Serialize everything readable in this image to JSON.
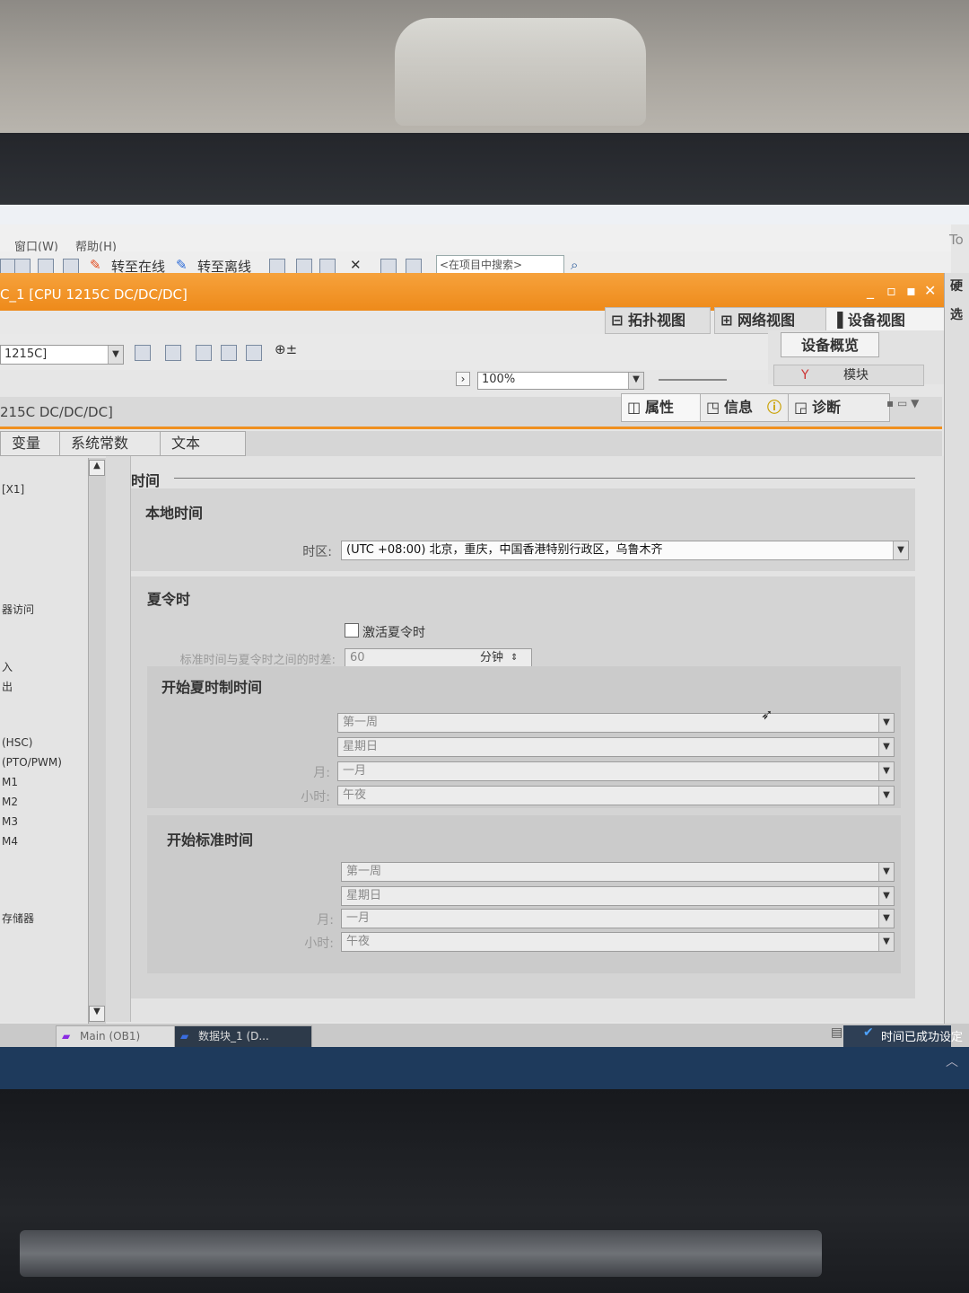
{
  "menu": {
    "window": "窗口(W)",
    "help": "帮助(H)"
  },
  "toolbar": {
    "go_online": "转至在线",
    "go_offline": "转至离线",
    "search_placeholder": "<在项目中搜索>"
  },
  "right_edge": {
    "top_text": "To",
    "tab_1": "硬",
    "tab_2": "选"
  },
  "window": {
    "title": "C_1 [CPU 1215C DC/DC/DC]",
    "buttons": [
      "_",
      "▫",
      "▪",
      "✕"
    ]
  },
  "view_tabs": [
    {
      "label": "拓扑视图",
      "icon": "topology-icon"
    },
    {
      "label": "网络视图",
      "icon": "network-icon"
    },
    {
      "label": "设备视图",
      "icon": "device-icon"
    }
  ],
  "device_bar": {
    "device_select": "1215C]",
    "zoom": "100%"
  },
  "overview": {
    "tab": "设备概览",
    "module_header": "模块"
  },
  "inspector": {
    "title": "215C DC/DC/DC]",
    "tabs": [
      {
        "label": "属性",
        "icon": "properties-icon",
        "active": true
      },
      {
        "label": "信息",
        "icon": "info-icon",
        "active": false
      },
      {
        "label": "诊断",
        "icon": "diagnostics-icon",
        "active": false
      }
    ],
    "subtabs": [
      "变量",
      "系统常数",
      "文本"
    ]
  },
  "left_nav": {
    "items": [
      "[X1]",
      "器访问",
      "入",
      "出",
      "(HSC)",
      "(PTO/PWM)",
      "M1",
      "M2",
      "M3",
      "M4",
      "存储器"
    ]
  },
  "time_settings": {
    "section_title": "时间",
    "local_time": {
      "title": "本地时间",
      "timezone_label": "时区:",
      "timezone_value": "(UTC +08:00) 北京，重庆，中国香港特别行政区，乌鲁木齐"
    },
    "dst": {
      "title": "夏令时",
      "activate_label": "激活夏令时",
      "activate_checked": false,
      "offset_label": "标准时间与夏令时之间的时差:",
      "offset_value": "60",
      "offset_unit": "分钟"
    },
    "dst_start": {
      "title": "开始夏时制时间",
      "week": "第一周",
      "weekday": "星期日",
      "month_label": "月:",
      "month": "一月",
      "hour_label": "小时:",
      "hour": "午夜"
    },
    "std_start": {
      "title": "开始标准时间",
      "week": "第一周",
      "weekday": "星期日",
      "month_label": "月:",
      "month": "一月",
      "hour_label": "小时:",
      "hour": "午夜"
    }
  },
  "status_bar": {
    "tabs": [
      {
        "label": "Main (OB1)",
        "icon": "ob-icon"
      },
      {
        "label": "数据块_1 (D...",
        "icon": "db-icon"
      }
    ],
    "message": "时间已成功设定"
  },
  "colors": {
    "accent_orange": "#ee8a1a",
    "status_blue": "#1e3a5c"
  }
}
